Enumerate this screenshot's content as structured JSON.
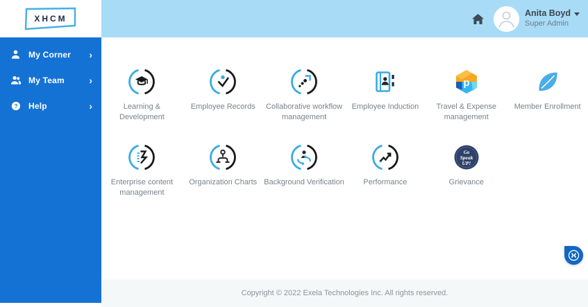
{
  "logo": {
    "text": "XHCM"
  },
  "sidebar": {
    "items": [
      {
        "label": "My Corner",
        "icon": "person-icon"
      },
      {
        "label": "My Team",
        "icon": "people-icon"
      },
      {
        "label": "Help",
        "icon": "question-icon"
      }
    ]
  },
  "header": {
    "user": {
      "name": "Anita Boyd",
      "role": "Super Admin"
    }
  },
  "apps": {
    "rows": [
      [
        {
          "label": "Learning & Development",
          "icon": "graduation-cap"
        },
        {
          "label": "Employee Records",
          "icon": "person-check"
        },
        {
          "label": "Collaborative workflow management",
          "icon": "dotted-arrow"
        },
        {
          "label": "Employee Induction",
          "icon": "induction-book"
        },
        {
          "label": "Travel & Expense management",
          "icon": "hexagon-p"
        },
        {
          "label": "Member Enrollment",
          "icon": "leaf"
        }
      ],
      [
        {
          "label": "Enterprise content management",
          "icon": "content-ribbon"
        },
        {
          "label": "Organization Charts",
          "icon": "org-chart"
        },
        {
          "label": "Background Verification",
          "icon": "person-sync"
        },
        {
          "label": "Performance",
          "icon": "trend-arrow"
        },
        {
          "label": "Grievance",
          "icon": "speak-up-badge",
          "badge_text": "Go Speak UP!"
        }
      ]
    ]
  },
  "footer": {
    "copyright": "Copyright © 2022 Exela Technologies Inc. All rights reserved."
  },
  "colors": {
    "sidebar_blue": "#1472d4",
    "header_blue": "#a8dcf6",
    "icon_blue": "#38abe5",
    "icon_dark": "#17191c",
    "accent_orange": "#f6a723",
    "badge_navy": "#2e4168",
    "fab_blue": "#1167c1",
    "footer_bg": "#f5f8f9"
  }
}
